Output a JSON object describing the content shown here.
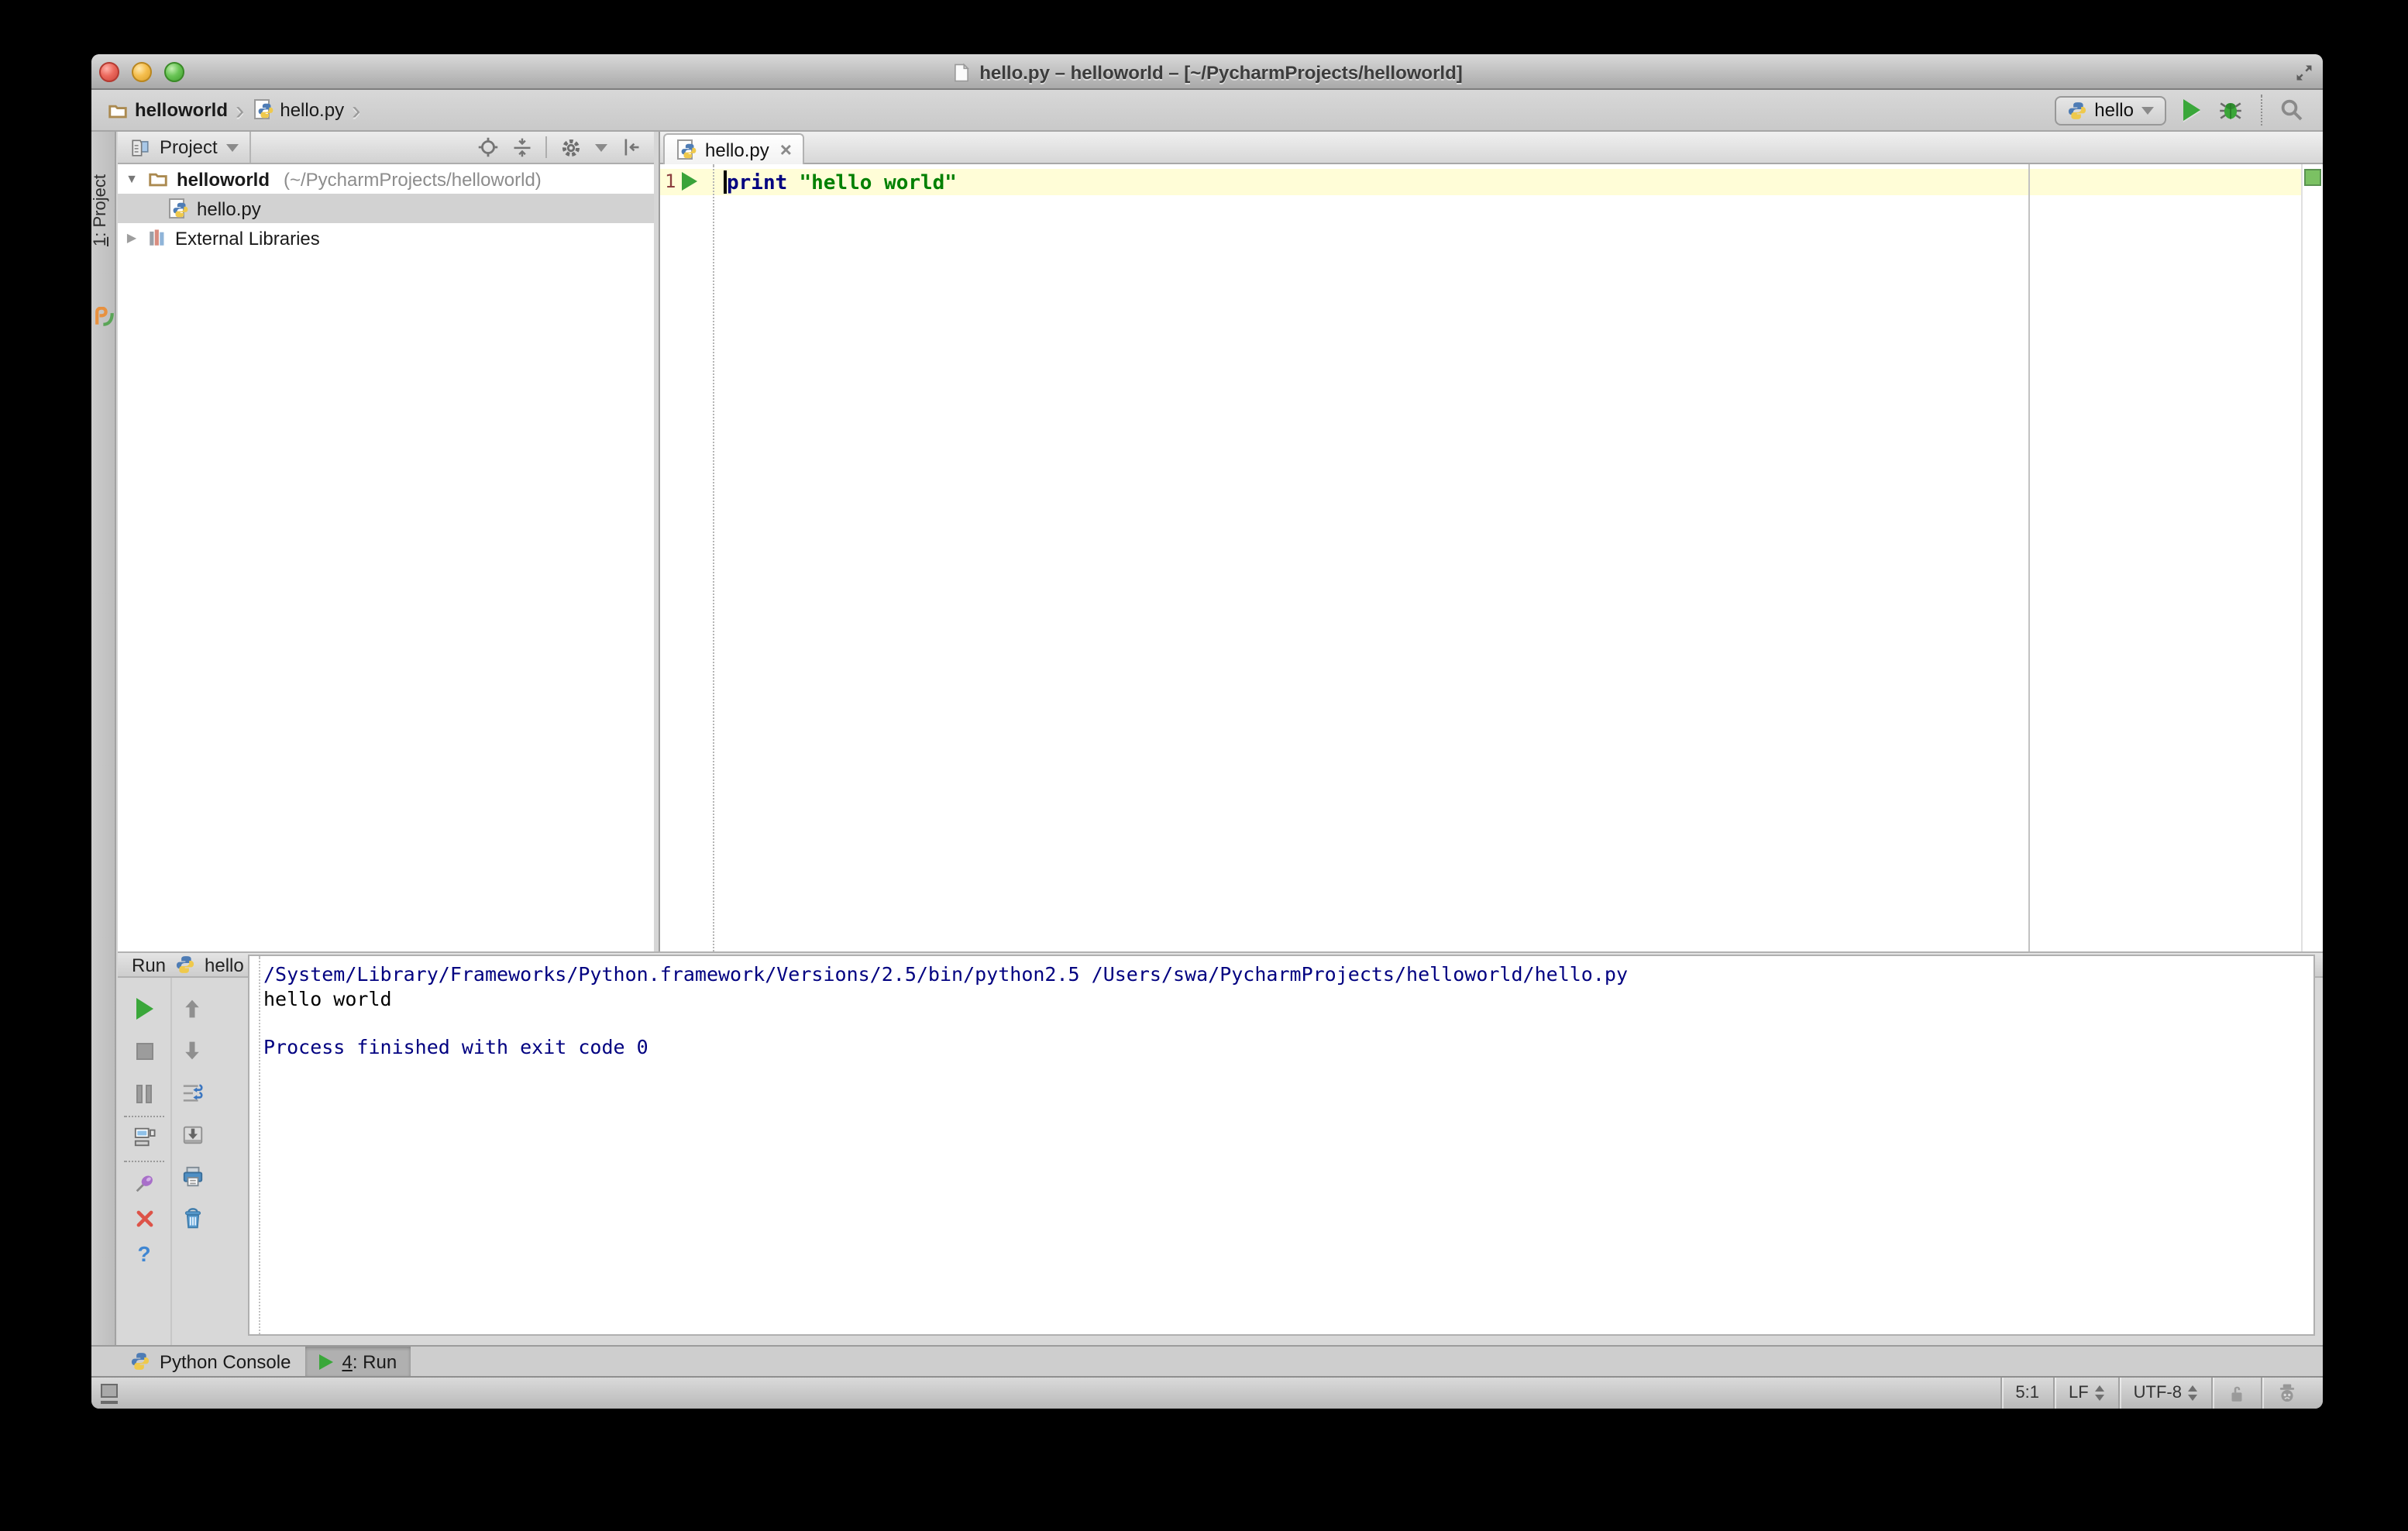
{
  "titlebar": {
    "title": "hello.py – helloworld – [~/PycharmProjects/helloworld]"
  },
  "navbar": {
    "breadcrumbs": [
      {
        "label": "helloworld"
      },
      {
        "label": "hello.py"
      }
    ],
    "run_config": {
      "name": "hello"
    }
  },
  "left_strip": {
    "project_button": {
      "number": "1",
      "label": ": Project"
    }
  },
  "project_panel": {
    "header": {
      "title": "Project"
    },
    "tree": [
      {
        "name": "helloworld",
        "detail": "(~/PycharmProjects/helloworld)"
      },
      {
        "name": "hello.py"
      },
      {
        "name": "External Libraries"
      }
    ]
  },
  "editor": {
    "tab": {
      "label": "hello.py",
      "close": "×"
    },
    "gutter": {
      "line_number": "1"
    },
    "code": {
      "keyword": "print",
      "string": "\"hello world\""
    }
  },
  "run_panel": {
    "header": {
      "prefix": "Run",
      "config_name": "hello"
    },
    "console": [
      {
        "text": "/System/Library/Frameworks/Python.framework/Versions/2.5/bin/python2.5 /Users/swa/PycharmProjects/helloworld/hello.py"
      },
      {
        "text": "hello world"
      },
      {
        "text": ""
      },
      {
        "text": "Process finished with exit code 0"
      }
    ]
  },
  "toolwindow_bar": {
    "python_console": {
      "label": "Python Console"
    },
    "run_tab": {
      "number": "4",
      "label": ": Run"
    }
  },
  "status_bar": {
    "caret_position": "5:1",
    "line_separator": "LF",
    "encoding": "UTF-8"
  },
  "colors": {
    "keyword": "#000080",
    "string": "#008000",
    "console_info": "#000080",
    "console_stdout": "#000000",
    "current_line": "#fffdd7",
    "run_green": "#3aa73a",
    "selection_gray": "#d2d2d2",
    "inspection_indicator": "#7bc163"
  },
  "icons": [
    "document-icon",
    "folder-icon",
    "python-icon",
    "run-icon",
    "debug-icon",
    "search-icon",
    "target-icon",
    "collapse-all-icon",
    "gear-icon",
    "hide-panel-icon",
    "books-icon",
    "rerun-icon",
    "stop-icon",
    "pause-icon",
    "restore-layout-icon",
    "pin-icon",
    "close-icon",
    "help-icon",
    "up-stack-icon",
    "down-stack-icon",
    "soft-wrap-icon",
    "scroll-to-end-icon",
    "print-icon",
    "clear-all-icon",
    "unlock-icon",
    "inspector-icon",
    "toggle-toolwindows-icon",
    "fullscreen-icon"
  ]
}
